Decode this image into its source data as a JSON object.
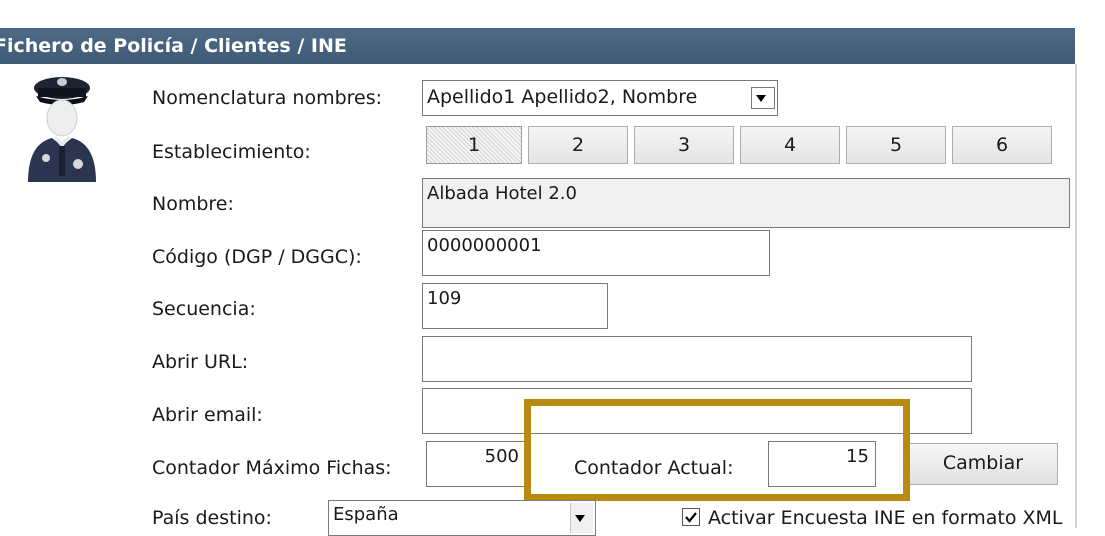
{
  "header": {
    "title": "Fichero de Policía / Clientes / INE"
  },
  "labels": {
    "nomenclatura": "Nomenclatura nombres:",
    "establecimiento": "Establecimiento:",
    "nombre": "Nombre:",
    "codigo": "Código (DGP / DGGC):",
    "secuencia": "Secuencia:",
    "abrir_url": "Abrir URL:",
    "abrir_email": "Abrir email:",
    "contador_maximo": "Contador Máximo Fichas:",
    "contador_actual": "Contador Actual:",
    "pais_destino": "País destino:"
  },
  "fields": {
    "nomenclatura_value": "Apellido1 Apellido2, Nombre",
    "nombre_value": "Albada Hotel 2.0",
    "codigo_value": "0000000001",
    "secuencia_value": "109",
    "abrir_url_value": "",
    "abrir_email_value": "",
    "contador_maximo_value": "500",
    "contador_actual_value": "15",
    "pais_destino_value": "España"
  },
  "establecimiento_tabs": [
    "1",
    "2",
    "3",
    "4",
    "5",
    "6"
  ],
  "active_tab": "1",
  "buttons": {
    "cambiar": "Cambiar"
  },
  "checkbox": {
    "label": "Activar Encuesta INE en formato XML",
    "checked": true
  },
  "colors": {
    "header_bg": "#46617d",
    "highlight_border": "#b88a12"
  },
  "icons": {
    "officer": "police-officer-icon"
  }
}
